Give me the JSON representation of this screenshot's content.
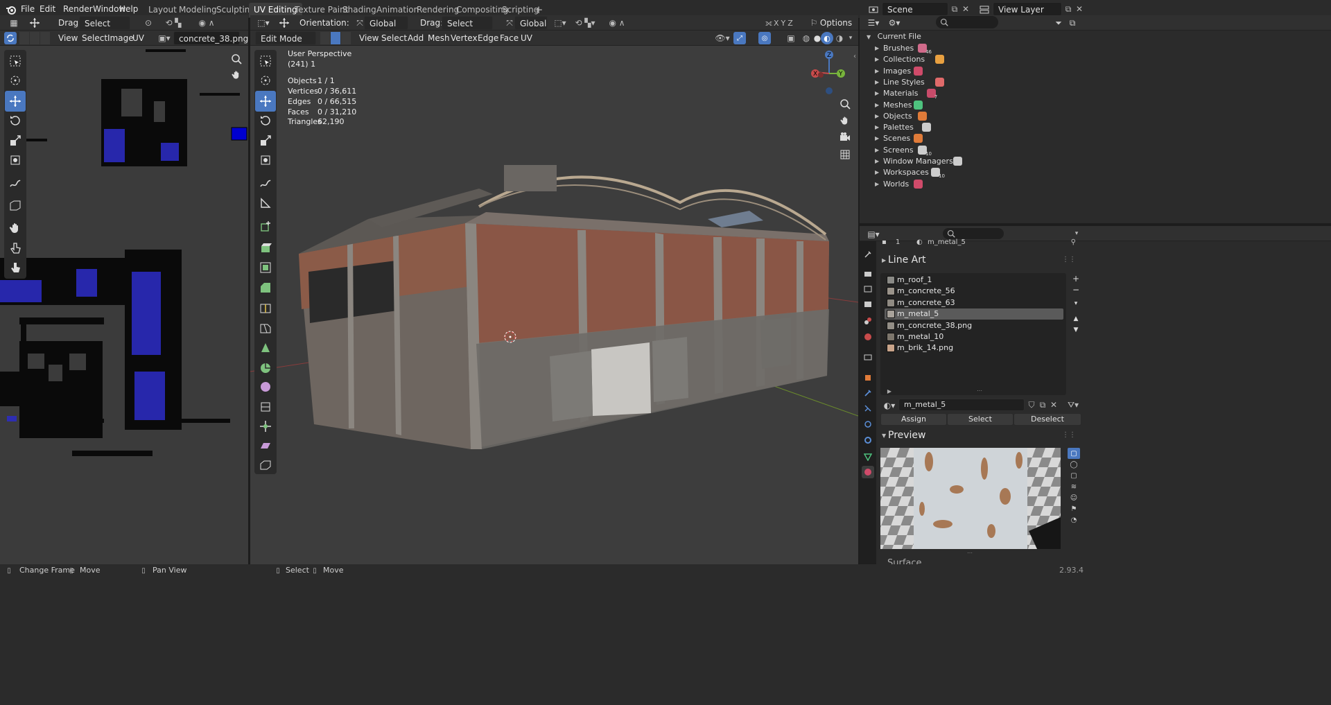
{
  "menu": {
    "file": "File",
    "edit": "Edit",
    "render": "Render",
    "window": "Window",
    "help": "Help"
  },
  "workspaces": [
    "Layout",
    "Modeling",
    "Sculpting",
    "UV Editing",
    "Texture Paint",
    "Shading",
    "Animation",
    "Rendering",
    "Compositing",
    "Scripting"
  ],
  "active_workspace": "UV Editing",
  "topbar": {
    "scene": "Scene",
    "view_layer": "View Layer"
  },
  "uv_editor": {
    "drag_label": "Drag:",
    "drag_value": "Select Box",
    "menus": {
      "view": "View",
      "select": "Select",
      "image": "Image",
      "uv": "UV"
    },
    "image_name": "concrete_38.png"
  },
  "viewport": {
    "orientation_label": "Orientation:",
    "orientation_value": "Global",
    "drag_label": "Drag:",
    "drag_value": "Select Box",
    "pivot_value": "Global",
    "options": "Options",
    "mode": "Edit Mode",
    "menus": {
      "view": "View",
      "select": "Select",
      "add": "Add",
      "mesh": "Mesh",
      "vertex": "Vertex",
      "edge": "Edge",
      "face": "Face",
      "uv": "UV"
    },
    "axis_x": "X",
    "axis_y": "Y",
    "axis_z": "Z",
    "perspective": "User Perspective",
    "frame": "(241) 1",
    "stats": [
      {
        "label": "Objects",
        "value": "1 / 1"
      },
      {
        "label": "Vertices",
        "value": "0 / 36,611"
      },
      {
        "label": "Edges",
        "value": "0 / 66,515"
      },
      {
        "label": "Faces",
        "value": "0 / 31,210"
      },
      {
        "label": "Triangles",
        "value": "62,190"
      }
    ]
  },
  "outliner": {
    "root": "Current File",
    "items": [
      {
        "label": "Brushes",
        "badge": "46"
      },
      {
        "label": "Collections",
        "badge": ""
      },
      {
        "label": "Images",
        "badge": ""
      },
      {
        "label": "Line Styles",
        "badge": ""
      },
      {
        "label": "Materials",
        "badge": "7"
      },
      {
        "label": "Meshes",
        "badge": ""
      },
      {
        "label": "Objects",
        "badge": ""
      },
      {
        "label": "Palettes",
        "badge": ""
      },
      {
        "label": "Scenes",
        "badge": ""
      },
      {
        "label": "Screens",
        "badge": "10"
      },
      {
        "label": "Window Managers",
        "badge": ""
      },
      {
        "label": "Workspaces",
        "badge": "10"
      },
      {
        "label": "Worlds",
        "badge": ""
      }
    ]
  },
  "properties": {
    "slot_index": "1",
    "object_material": "m_metal_5",
    "section_line_art": "Line Art",
    "materials": [
      {
        "name": "m_roof_1",
        "color": "#8a8a86"
      },
      {
        "name": "m_concrete_56",
        "color": "#9a938a"
      },
      {
        "name": "m_concrete_63",
        "color": "#8f8a82"
      },
      {
        "name": "m_metal_5",
        "color": "#a8a29a"
      },
      {
        "name": "m_concrete_38.png",
        "color": "#938e86"
      },
      {
        "name": "m_metal_10",
        "color": "#7d766c"
      },
      {
        "name": "m_brik_14.png",
        "color": "#c9a48a"
      }
    ],
    "selected_index": 3,
    "material_field": "m_metal_5",
    "assign": "Assign",
    "select": "Select",
    "deselect": "Deselect",
    "section_preview": "Preview",
    "section_surface": "Surface"
  },
  "statusbar": {
    "change_frame": "Change Frame",
    "move1": "Move",
    "pan_view": "Pan View",
    "select": "Select",
    "move2": "Move",
    "version": "2.93.4"
  },
  "colors": {
    "accent": "#4a78c0",
    "selected_row": "#5a5a5a",
    "active_tab": "#3d3d3d"
  }
}
